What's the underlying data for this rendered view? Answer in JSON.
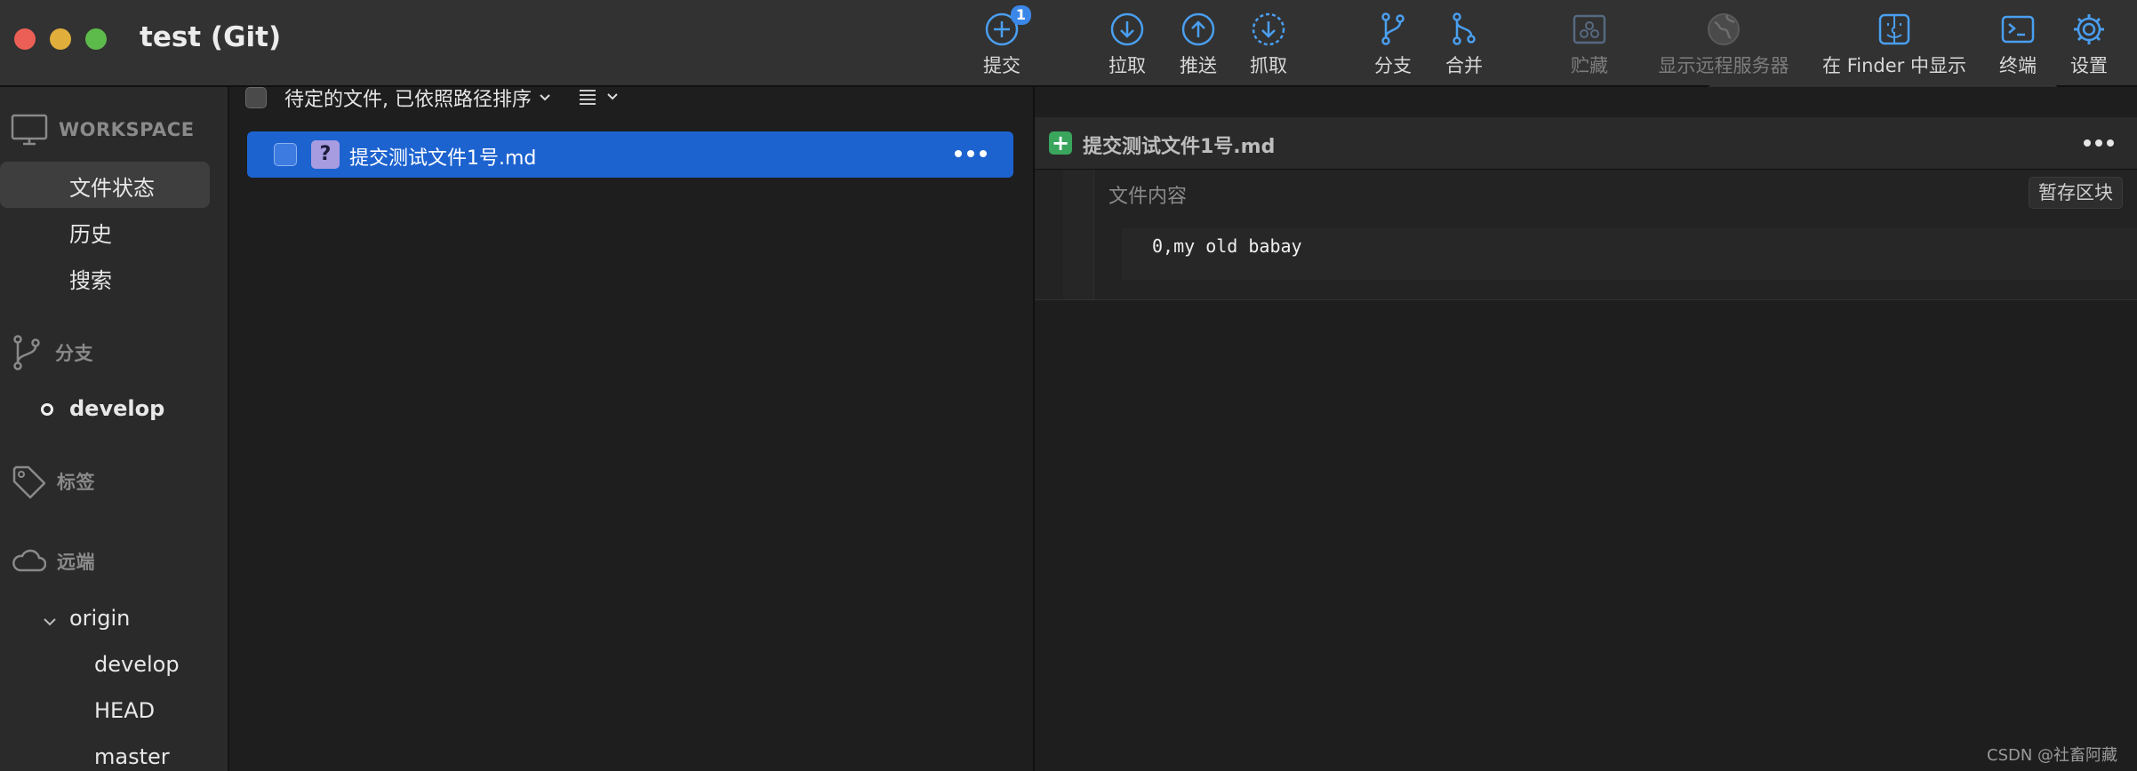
{
  "window": {
    "title": "test (Git)"
  },
  "toolbar": {
    "commit": {
      "label": "提交",
      "badge": "1"
    },
    "pull": {
      "label": "拉取"
    },
    "push": {
      "label": "推送"
    },
    "fetch": {
      "label": "抓取"
    },
    "branch": {
      "label": "分支"
    },
    "merge": {
      "label": "合并"
    },
    "stash": {
      "label": "贮藏"
    },
    "remote": {
      "label": "显示远程服务器"
    },
    "finder": {
      "label": "在 Finder 中显示"
    },
    "terminal": {
      "label": "终端"
    },
    "settings": {
      "label": "设置"
    }
  },
  "sidebar": {
    "workspace": {
      "header": "WORKSPACE",
      "items": [
        "文件状态",
        "历史",
        "搜索"
      ]
    },
    "branches": {
      "header": "分支",
      "items": [
        "develop"
      ]
    },
    "tags": {
      "header": "标签"
    },
    "remotes": {
      "header": "远端",
      "origin": {
        "name": "origin",
        "branches": [
          "develop",
          "HEAD",
          "master"
        ]
      }
    }
  },
  "file_list": {
    "sort_label": "待定的文件, 已依照路径排序",
    "files": [
      {
        "name": "提交测试文件1号.md",
        "status": "?"
      }
    ]
  },
  "search": {
    "placeholder": "搜索"
  },
  "diff": {
    "file_name": "提交测试文件1号.md",
    "section_title": "文件内容",
    "stage_button": "暂存区块",
    "lines": [
      "0,my old babay"
    ]
  },
  "watermark": "CSDN @社畜阿藏",
  "colors": {
    "accent": "#1d63d0",
    "toolbar_icon": "#4a9ff0",
    "added": "#3aa55d"
  }
}
